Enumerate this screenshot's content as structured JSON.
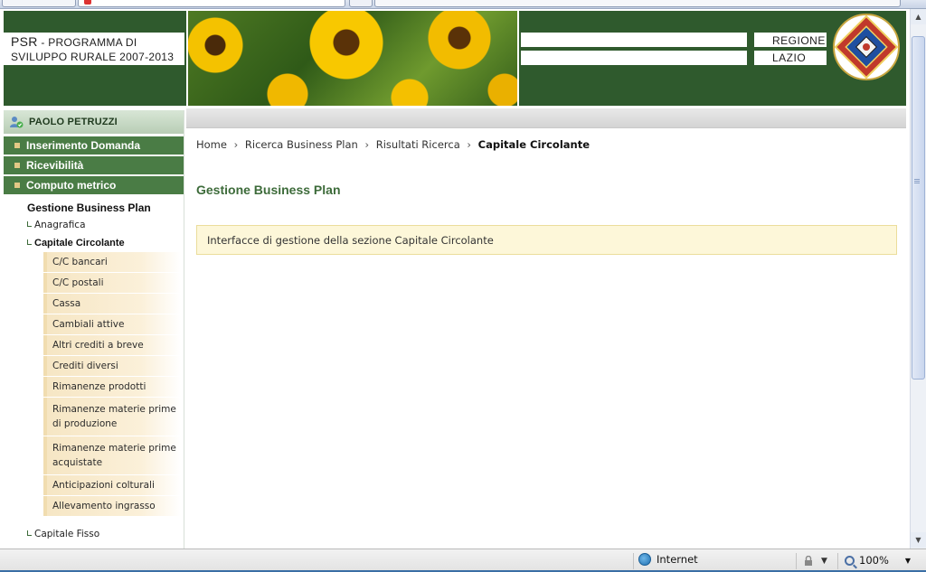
{
  "header": {
    "psr": "PSR",
    "programma": "-  PROGRAMMA DI",
    "line2": "SVILUPPO RURALE 2007-2013",
    "regione": "REGIONE",
    "lazio": "LAZIO"
  },
  "sidebar": {
    "user_name": "PAOLO PETRUZZI",
    "main_menu": [
      {
        "label": "Inserimento Domanda"
      },
      {
        "label": "Ricevibilità"
      },
      {
        "label": "Computo metrico"
      }
    ],
    "section_title": "Gestione Business Plan",
    "sub_anagrafica": "Anagrafica",
    "sub_capitale_circolante": "Capitale Circolante",
    "leaves": [
      {
        "label": "C/C bancari"
      },
      {
        "label": "C/C postali"
      },
      {
        "label": "Cassa"
      },
      {
        "label": "Cambiali attive"
      },
      {
        "label": "Altri crediti a breve"
      },
      {
        "label": "Crediti diversi"
      },
      {
        "label": "Rimanenze prodotti"
      },
      {
        "label": "Rimanenze materie prime di produzione"
      },
      {
        "label": "Rimanenze materie prime acquistate"
      },
      {
        "label": "Anticipazioni colturali"
      },
      {
        "label": "Allevamento ingrasso"
      }
    ],
    "sub_capitale_fisso": "Capitale Fisso"
  },
  "breadcrumb": {
    "items": [
      "Home",
      "Ricerca Business Plan",
      "Risultati Ricerca"
    ],
    "current": "Capitale Circolante",
    "separator": "›"
  },
  "main": {
    "title": "Gestione Business Plan",
    "info": "Interfacce di gestione della sezione Capitale Circolante"
  },
  "statusbar": {
    "zone": "Internet",
    "zoom": "100%"
  },
  "colors": {
    "header_green": "#2f5a2d",
    "menu_green": "#4a7c45",
    "title_green": "#3d6b3a",
    "leaf_bg": "#f6e6c4",
    "info_bg": "#fdf7d9"
  }
}
